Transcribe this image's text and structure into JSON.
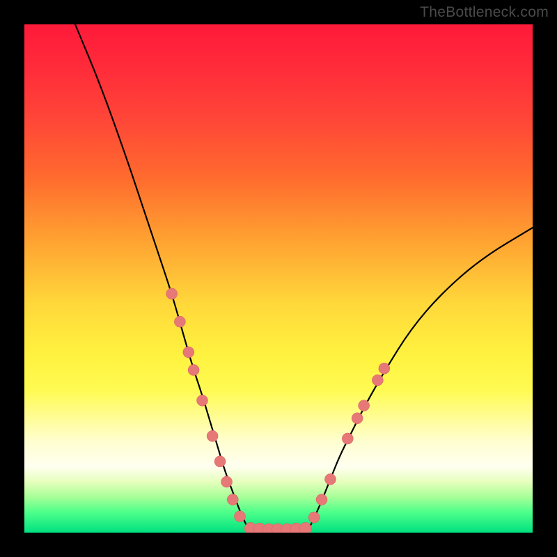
{
  "watermark": "TheBottleneck.com",
  "colors": {
    "background": "#000000",
    "curve": "#000000",
    "marker_fill": "#e77878",
    "marker_stroke": "#da5b5b"
  },
  "chart_data": {
    "type": "line",
    "title": "",
    "xlabel": "",
    "ylabel": "",
    "xlim": [
      0,
      100
    ],
    "ylim": [
      0,
      100
    ],
    "grid": false,
    "plot_background": "rainbow-vertical-gradient",
    "series": [
      {
        "name": "left-curve",
        "x": [
          10,
          15,
          20,
          23,
          26,
          29,
          31,
          33,
          35,
          36.5,
          38,
          39.5,
          41,
          42.5,
          44
        ],
        "y": [
          100,
          88,
          74,
          65,
          56,
          47,
          40,
          33,
          27,
          22,
          17,
          12,
          8,
          4,
          0.8
        ]
      },
      {
        "name": "right-curve",
        "x": [
          56,
          58,
          60,
          62,
          64,
          67,
          71,
          76,
          82,
          90,
          100
        ],
        "y": [
          0.8,
          5,
          10,
          15,
          19,
          25,
          32,
          40,
          47,
          54,
          60
        ]
      },
      {
        "name": "bottom-flat",
        "x": [
          44,
          46,
          48,
          50,
          52,
          54,
          56
        ],
        "y": [
          0.8,
          0.6,
          0.6,
          0.6,
          0.6,
          0.6,
          0.8
        ]
      }
    ],
    "markers": [
      {
        "x": 29.0,
        "y": 47.0,
        "r": 1.1
      },
      {
        "x": 30.6,
        "y": 41.5,
        "r": 1.1
      },
      {
        "x": 32.3,
        "y": 35.5,
        "r": 1.1
      },
      {
        "x": 33.3,
        "y": 32.0,
        "r": 1.1
      },
      {
        "x": 35.0,
        "y": 26.0,
        "r": 1.1
      },
      {
        "x": 37.0,
        "y": 19.0,
        "r": 1.1
      },
      {
        "x": 38.5,
        "y": 14.0,
        "r": 1.1
      },
      {
        "x": 39.8,
        "y": 10.0,
        "r": 1.1
      },
      {
        "x": 41.0,
        "y": 6.5,
        "r": 1.1
      },
      {
        "x": 42.4,
        "y": 3.2,
        "r": 1.1
      },
      {
        "x": 44.5,
        "y": 0.8,
        "r": 1.2
      },
      {
        "x": 46.3,
        "y": 0.7,
        "r": 1.2
      },
      {
        "x": 48.1,
        "y": 0.6,
        "r": 1.2
      },
      {
        "x": 49.9,
        "y": 0.6,
        "r": 1.2
      },
      {
        "x": 51.7,
        "y": 0.6,
        "r": 1.2
      },
      {
        "x": 53.5,
        "y": 0.7,
        "r": 1.2
      },
      {
        "x": 55.3,
        "y": 0.8,
        "r": 1.2
      },
      {
        "x": 57.0,
        "y": 3.0,
        "r": 1.1
      },
      {
        "x": 58.5,
        "y": 6.5,
        "r": 1.1
      },
      {
        "x": 60.2,
        "y": 10.5,
        "r": 1.1
      },
      {
        "x": 63.6,
        "y": 18.5,
        "r": 1.1
      },
      {
        "x": 65.5,
        "y": 22.5,
        "r": 1.1
      },
      {
        "x": 66.8,
        "y": 25.0,
        "r": 1.1
      },
      {
        "x": 69.5,
        "y": 30.0,
        "r": 1.1
      },
      {
        "x": 70.8,
        "y": 32.3,
        "r": 1.1
      }
    ]
  }
}
